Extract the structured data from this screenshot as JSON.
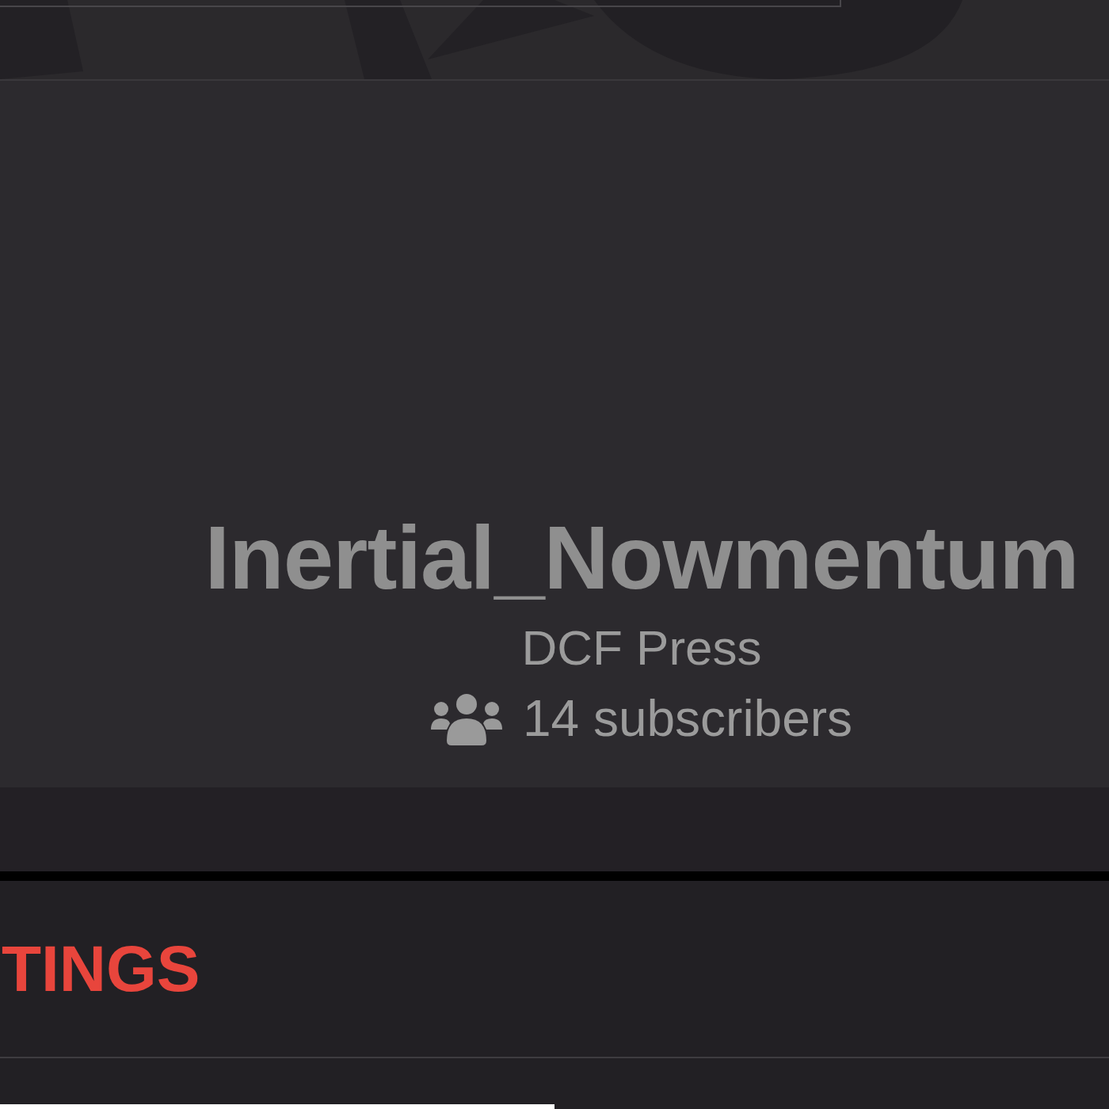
{
  "profile": {
    "name": "Inertial_Nowmentum",
    "publisher": "DCF Press",
    "subscribers": "14 subscribers"
  },
  "section": {
    "heading": "TINGS"
  }
}
